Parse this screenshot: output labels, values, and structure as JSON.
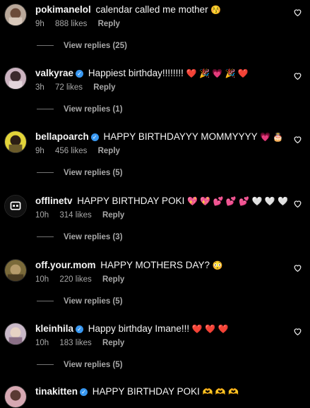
{
  "comments": [
    {
      "user": "pokimanelol",
      "verified": false,
      "text": "calendar called me mother",
      "emoji": "😚",
      "time": "9h",
      "likes": "888 likes",
      "reply": "Reply",
      "view_replies": "View replies (25)"
    },
    {
      "user": "valkyrae",
      "verified": true,
      "text": "Happiest birthday!!!!!!!!",
      "emoji": "❤️ 🎉 💗 🎉 ❤️",
      "time": "3h",
      "likes": "72 likes",
      "reply": "Reply",
      "view_replies": "View replies (1)"
    },
    {
      "user": "bellapoarch",
      "verified": true,
      "text": "HAPPY BIRTHDAYYY MOMMYYYY",
      "emoji": "💗 🎂",
      "time": "9h",
      "likes": "456 likes",
      "reply": "Reply",
      "view_replies": "View replies (5)"
    },
    {
      "user": "offlinetv",
      "verified": false,
      "text": "HAPPY BIRTHDAY POKI",
      "emoji": "💖 💖 💕 💕 💕 🤍 🤍 🤍",
      "time": "10h",
      "likes": "314 likes",
      "reply": "Reply",
      "view_replies": "View replies (3)"
    },
    {
      "user": "off.your.mom",
      "verified": false,
      "text": "HAPPY MOTHERS DAY?",
      "emoji": "😳",
      "time": "10h",
      "likes": "220 likes",
      "reply": "Reply",
      "view_replies": "View replies (5)"
    },
    {
      "user": "kleinhila",
      "verified": true,
      "text": "Happy birthday Imane!!!",
      "emoji": "❤️ ❤️ ❤️",
      "time": "10h",
      "likes": "183 likes",
      "reply": "Reply",
      "view_replies": "View replies (5)"
    },
    {
      "user": "tinakitten",
      "verified": true,
      "text": "HAPPY BIRTHDAY POKI",
      "emoji": "🫶 🫶 🫶",
      "time": "",
      "likes": "",
      "reply": "",
      "view_replies": ""
    }
  ],
  "icons": {
    "like": "heart-outline-icon",
    "verified": "verified-badge-icon"
  },
  "colors": {
    "background": "#000000",
    "text": "#f5f5f5",
    "muted": "#a8a8a8",
    "verified": "#3897f0"
  }
}
